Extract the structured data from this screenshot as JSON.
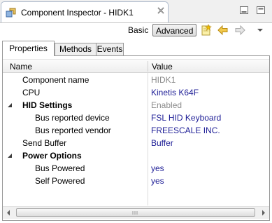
{
  "view": {
    "title": "Component Inspector - HIDK1",
    "icon": "component-inspector-icon",
    "close_icon": "close-x-icon"
  },
  "window_controls": {
    "minimize_icon": "minimize-icon",
    "maximize_icon": "maximize-icon"
  },
  "toolbar": {
    "basic_label": "Basic",
    "advanced_label": "Advanced",
    "icons": [
      "new-note-icon",
      "back-arrow-icon",
      "forward-arrow-icon",
      "view-menu-chevron-icon"
    ]
  },
  "tabs": [
    {
      "label": "Properties",
      "active": true
    },
    {
      "label": "Methods",
      "active": false
    },
    {
      "label": "Events",
      "active": false
    }
  ],
  "table": {
    "columns": [
      "Name",
      "Value"
    ],
    "rows": [
      {
        "name": "Component name",
        "value": "HIDK1",
        "level": 1,
        "bold": false,
        "value_style": "gray"
      },
      {
        "name": "CPU",
        "value": "Kinetis K64F",
        "level": 1,
        "bold": false,
        "value_style": "blue"
      },
      {
        "name": "HID Settings",
        "value": "Enabled",
        "level": 1,
        "bold": true,
        "expanded": true,
        "value_style": "gray"
      },
      {
        "name": "Bus reported device",
        "value": "FSL HID Keyboard",
        "level": 2,
        "bold": false,
        "value_style": "blue"
      },
      {
        "name": "Bus reported vendor",
        "value": "FREESCALE INC.",
        "level": 2,
        "bold": false,
        "value_style": "blue"
      },
      {
        "name": "Send Buffer",
        "value": "Buffer",
        "level": 1,
        "bold": false,
        "value_style": "blue"
      },
      {
        "name": "Power Options",
        "value": "",
        "level": 1,
        "bold": true,
        "expanded": true,
        "value_style": "blue"
      },
      {
        "name": "Bus Powered",
        "value": "yes",
        "level": 2,
        "bold": false,
        "value_style": "blue"
      },
      {
        "name": "Self Powered",
        "value": "yes",
        "level": 2,
        "bold": false,
        "value_style": "blue"
      }
    ]
  },
  "colors": {
    "value_blue": "#1d1d96",
    "value_gray": "#8c8c8c",
    "tab_border": "#a9b6c9"
  }
}
